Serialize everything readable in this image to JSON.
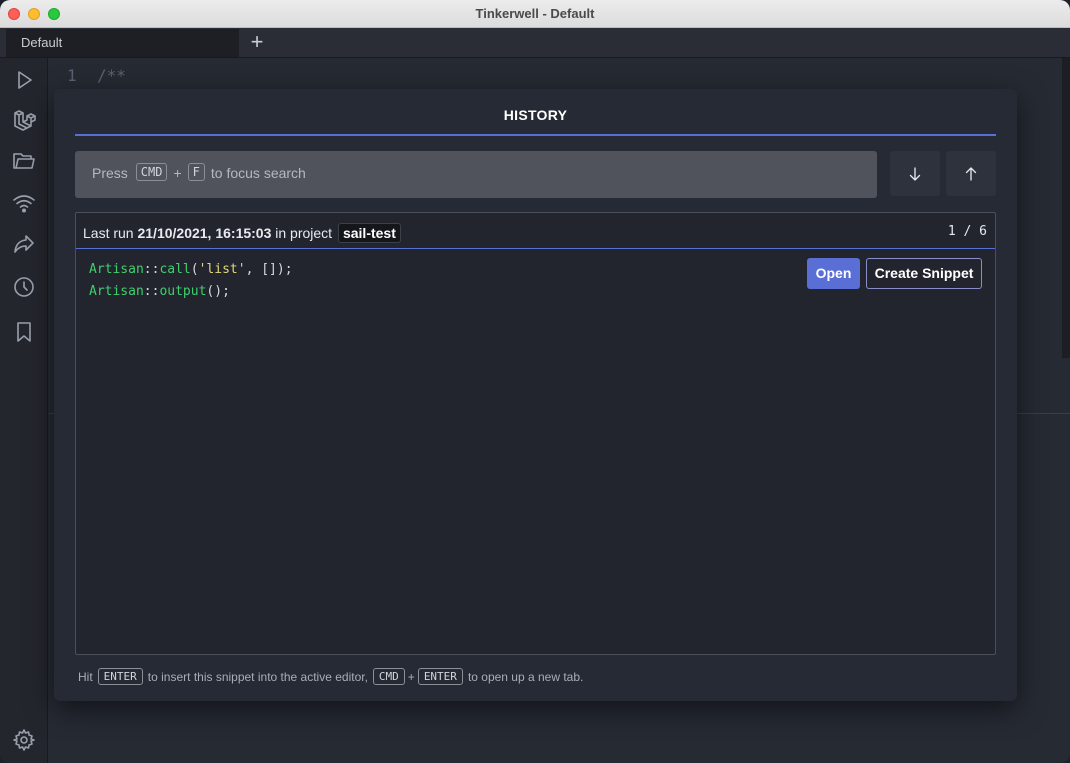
{
  "window": {
    "title": "Tinkerwell - Default"
  },
  "tabs": [
    {
      "label": "Default"
    }
  ],
  "tabbar": {
    "add_label": "+"
  },
  "sidebar": {
    "items": [
      {
        "icon": "play-icon"
      },
      {
        "icon": "laravel-icon"
      },
      {
        "icon": "folder-icon"
      },
      {
        "icon": "wifi-icon"
      },
      {
        "icon": "share-icon"
      },
      {
        "icon": "clock-icon"
      },
      {
        "icon": "bookmark-icon"
      },
      {
        "icon": "gear-icon"
      }
    ]
  },
  "editor": {
    "line_number": "1",
    "first_line": "/**"
  },
  "history": {
    "title": "HISTORY",
    "search": {
      "press": "Press",
      "key1": "CMD",
      "plus": "+",
      "key2": "F",
      "suffix": "to focus search"
    },
    "entry": {
      "last_run_label": "Last run",
      "timestamp": "21/10/2021, 16:15:03",
      "in_project": "in project",
      "project": "sail-test",
      "counter": "1 / 6",
      "code_lines": [
        {
          "class": "Artisan",
          "sep": "::",
          "fn": "call",
          "open": "(",
          "str": "'list'",
          "rest": ", []);"
        },
        {
          "class": "Artisan",
          "sep": "::",
          "fn": "output",
          "rest": "();"
        }
      ],
      "open_label": "Open",
      "snippet_label": "Create Snippet"
    },
    "footer": {
      "hit": "Hit",
      "key_enter": "ENTER",
      "text1": "to insert this snippet into the active editor,",
      "key_cmd": "CMD",
      "plus": "+",
      "key_enter2": "ENTER",
      "text2": "to open up a new tab."
    }
  }
}
